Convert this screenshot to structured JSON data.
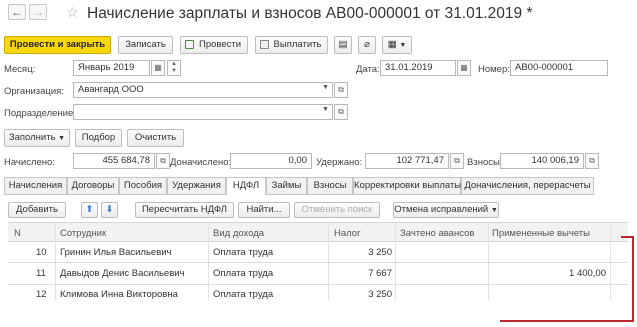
{
  "window": {
    "title": "Начисление зарплаты и взносов АВ00-000001 от 31.01.2019 *"
  },
  "toolbar": {
    "post_close": "Провести и закрыть",
    "save": "Записать",
    "post": "Провести",
    "pay": "Выплатить"
  },
  "form": {
    "month_label": "Месяц:",
    "month_value": "Январь 2019",
    "date_label": "Дата:",
    "date_value": "31.01.2019",
    "number_label": "Номер:",
    "number_value": "АВ00-000001",
    "org_label": "Организация:",
    "org_value": "Авангард ООО",
    "dept_label": "Подразделение:",
    "dept_value": ""
  },
  "actions": {
    "fill": "Заполнить",
    "select": "Подбор",
    "clear": "Очистить"
  },
  "totals": {
    "accrued_label": "Начислено:",
    "accrued_value": "455 684,78",
    "extra_label": "Доначислено:",
    "extra_value": "0,00",
    "withheld_label": "Удержано:",
    "withheld_value": "102 771,47",
    "contrib_label": "Взносы:",
    "contrib_value": "140 006,19"
  },
  "tabs": [
    "Начисления",
    "Договоры",
    "Пособия",
    "Удержания",
    "НДФЛ",
    "Займы",
    "Взносы",
    "Корректировки выплаты",
    "Доначисления, перерасчеты"
  ],
  "table_toolbar": {
    "add": "Добавить",
    "recalc": "Пересчитать НДФЛ",
    "find": "Найти...",
    "cancel_search": "Отменить поиск",
    "cancel_corrections": "Отмена исправлений"
  },
  "table": {
    "columns": [
      "N",
      "Сотрудник",
      "Вид дохода",
      "Налог",
      "Зачтено авансов",
      "Примененные вычеты"
    ],
    "rows": [
      {
        "n": "10",
        "employee": "Гринин Илья Васильевич",
        "income": "Оплата труда",
        "tax": "3 250",
        "advances": "",
        "deductions": ""
      },
      {
        "n": "11",
        "employee": "Давыдов Денис Васильевич",
        "income": "Оплата труда",
        "tax": "7 667",
        "advances": "",
        "deductions": "1 400,00"
      },
      {
        "n": "12",
        "employee": "Климова Инна Викторовна",
        "income": "Оплата труда",
        "tax": "3 250",
        "advances": "",
        "deductions": ""
      }
    ]
  },
  "colors": {
    "primary_button": "#f8d80c",
    "highlight_frame": "#c0272d"
  }
}
